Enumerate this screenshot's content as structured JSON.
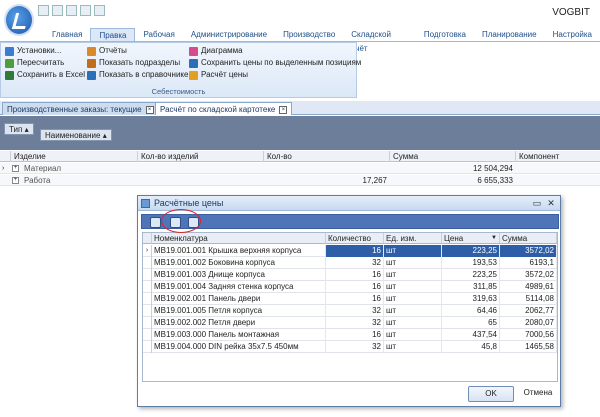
{
  "app": {
    "brand": "VOGBIT"
  },
  "tabs": [
    "Главная",
    "Правка",
    "Рабочая",
    "Администрирование",
    "Производство",
    "Складской учёт",
    "Подготовка",
    "Планирование",
    "Настройка"
  ],
  "active_tab": "Правка",
  "ribbon": {
    "col1": [
      "Установки...",
      "Пересчитать",
      "Сохранить в Excel"
    ],
    "col2": [
      "Отчёты",
      "Показать подразделы",
      "Показать в справочнике"
    ],
    "col3": [
      "Диаграмма",
      "Сохранить цены по выделенным позициям",
      "Расчёт цены"
    ],
    "group_label": "Себестоимость"
  },
  "doc_tabs": [
    "Производственные заказы: текущие",
    "Расчёт по складской картотеке"
  ],
  "group_panel": {
    "buttons": [
      "Тип",
      "Наименование"
    ]
  },
  "main_grid": {
    "headers": [
      "Изделие",
      "Кол-во изделий",
      "Кол-во",
      "Сумма",
      "Компонент"
    ],
    "rows": [
      {
        "name": "Материал",
        "qty": "",
        "sum": "12 504,294"
      },
      {
        "name": "Работа",
        "qty": "17,267",
        "sum": "6 655,333"
      }
    ]
  },
  "dialog": {
    "title": "Расчётные цены",
    "headers": [
      "Номенклатура",
      "Количество",
      "Ед. изм.",
      "Цена",
      "Сумма"
    ],
    "rows": [
      {
        "name": "МВ19.001.001 Крышка верхняя корпуса",
        "qty": "16",
        "unit": "шт",
        "price": "223,25",
        "sum": "3572,02"
      },
      {
        "name": "МВ19.001.002 Боковина корпуса",
        "qty": "32",
        "unit": "шт",
        "price": "193,53",
        "sum": "6193,1"
      },
      {
        "name": "МВ19.001.003 Днище корпуса",
        "qty": "16",
        "unit": "шт",
        "price": "223,25",
        "sum": "3572,02"
      },
      {
        "name": "МВ19.001.004 Задняя стенка корпуса",
        "qty": "16",
        "unit": "шт",
        "price": "311,85",
        "sum": "4989,61"
      },
      {
        "name": "МВ19.002.001 Панель двери",
        "qty": "16",
        "unit": "шт",
        "price": "319,63",
        "sum": "5114,08"
      },
      {
        "name": "МВ19.001.005 Петля корпуса",
        "qty": "32",
        "unit": "шт",
        "price": "64,46",
        "sum": "2062,77"
      },
      {
        "name": "МВ19.002.002 Петля двери",
        "qty": "32",
        "unit": "шт",
        "price": "65",
        "sum": "2080,07"
      },
      {
        "name": "МВ19.003.000 Панель монтажная",
        "qty": "16",
        "unit": "шт",
        "price": "437,54",
        "sum": "7000,56"
      },
      {
        "name": "МВ19.004.000 DIN рейка 35x7.5 450мм",
        "qty": "32",
        "unit": "шт",
        "price": "45,8",
        "sum": "1465,58"
      }
    ],
    "ok": "OK",
    "cancel": "Отмена"
  }
}
